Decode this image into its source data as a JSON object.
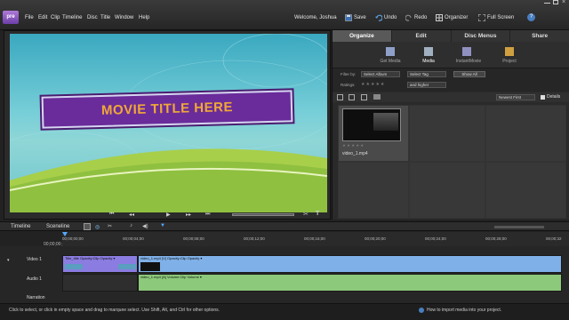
{
  "app": {
    "logo": "pre"
  },
  "menu": [
    "File",
    "Edit",
    "Clip",
    "Timeline",
    "Disc",
    "Title",
    "Window",
    "Help"
  ],
  "header": {
    "welcome": "Welcome, Joshua",
    "save": "Save",
    "undo": "Undo",
    "redo": "Redo",
    "organizer": "Organizer",
    "fullscreen": "Full Screen"
  },
  "preview": {
    "title_text": "MOVIE TITLE HERE",
    "timecode": "00;00;00;00"
  },
  "panel": {
    "tabs": [
      "Organize",
      "Edit",
      "Disc Menus",
      "Share"
    ],
    "subnav": [
      "Get Media",
      "Media",
      "InstantMovie",
      "Project"
    ],
    "filter_by_label": "Filter by:",
    "select_album": "Select Album",
    "select_tag": "Select Tag",
    "show_all": "Show All",
    "ratings_label": "Ratings:",
    "and_higher": "and higher",
    "sort": "Newest First",
    "details": "Details",
    "media_item": "video_1.mp4"
  },
  "timeline": {
    "tabs": [
      "Timeline",
      "Sceneline"
    ],
    "ruler": [
      "00;00;00;00",
      "00;00;04;00",
      "00;00;08;00",
      "00;00;12;00",
      "00;00;16;00",
      "00;00;20;00",
      "00;00;24;00",
      "00;00;28;00",
      "00;00;32"
    ],
    "tracks": [
      "Video 1",
      "Audio 1",
      "Narration"
    ],
    "clips": {
      "title": "Title_title  Opacity:Clip Opacity ▾",
      "video": "video_1.mp4 [V]  Opacity:Clip Opacity ▾",
      "audio": "video_1.mp4 [A]  Volume:Clip Volume ▾"
    }
  },
  "status": {
    "left": "Click to select, or click in empty space and drag to marquee select. Use Shift, Alt, and Ctrl for other options.",
    "right": "How to import media into your project."
  },
  "colors": {
    "accent": "#6a2c9a",
    "title_text": "#f0a838",
    "video_clip": "#7fb0e8",
    "audio_clip": "#8cc97a"
  }
}
